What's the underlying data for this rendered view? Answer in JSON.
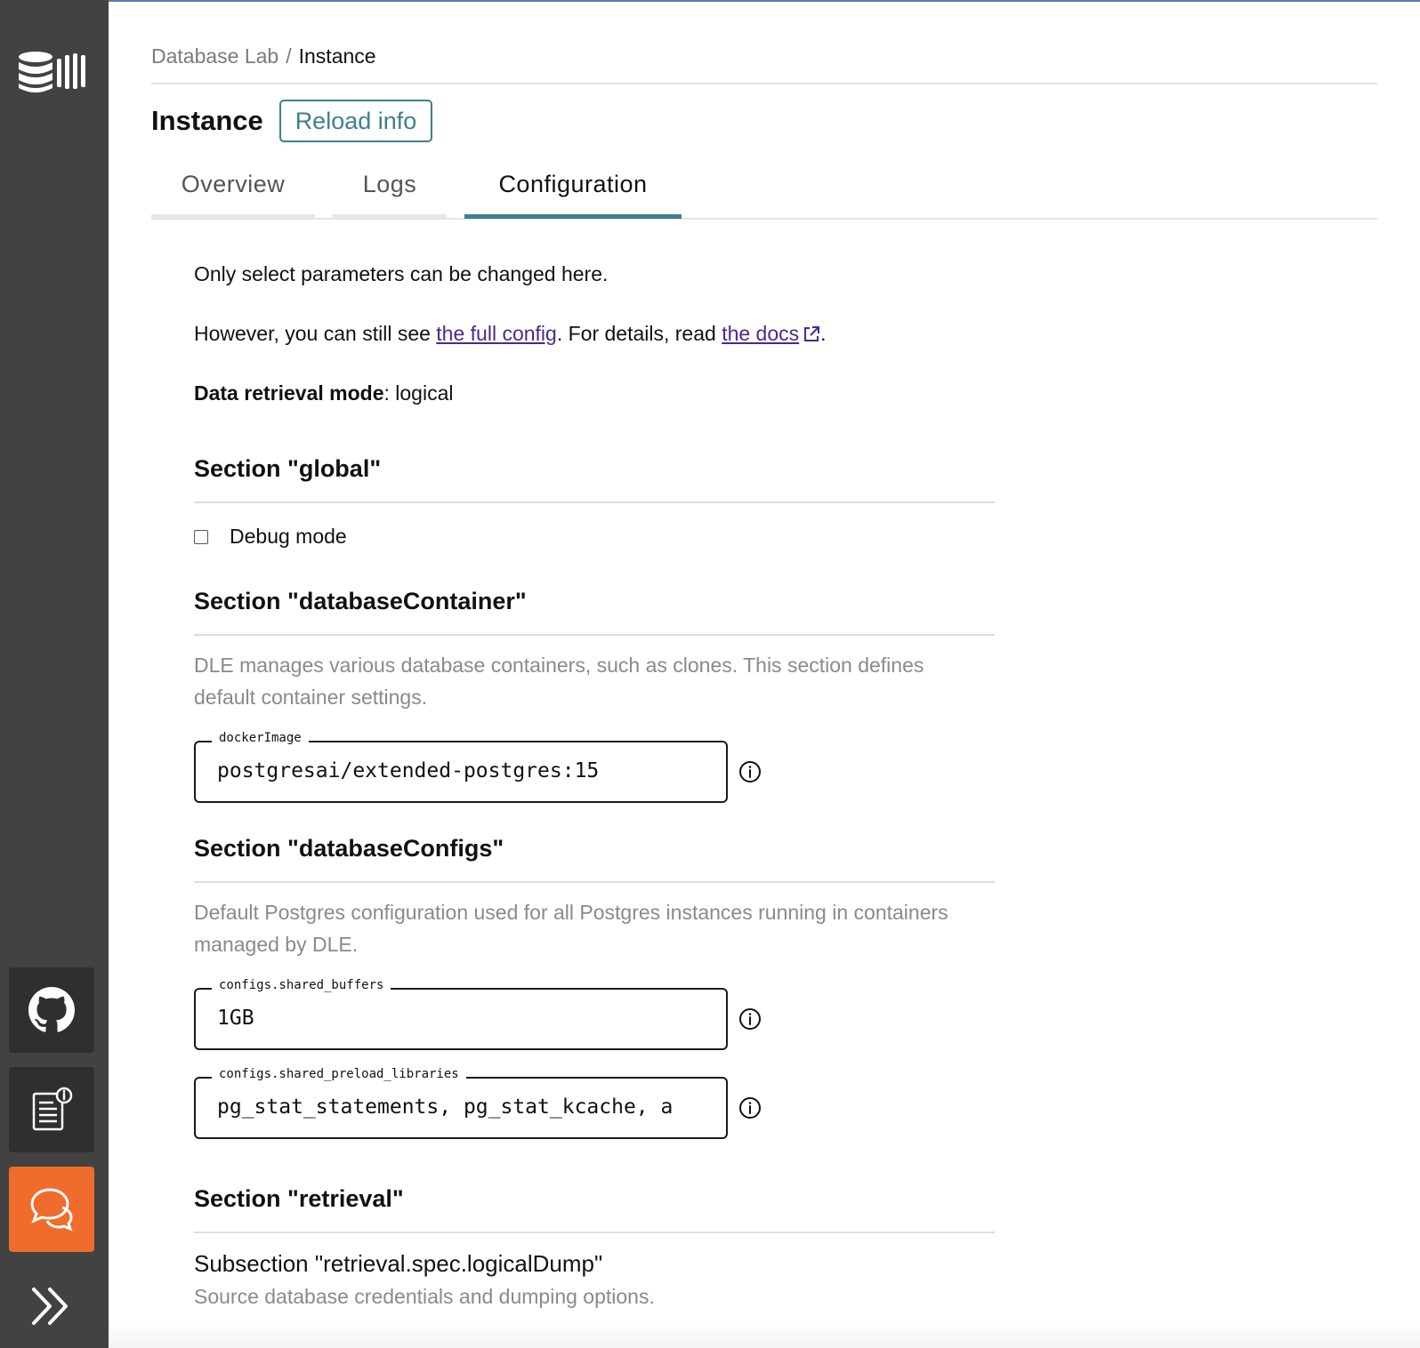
{
  "breadcrumb": {
    "root": "Database Lab",
    "separator": "/",
    "current": "Instance"
  },
  "page": {
    "title": "Instance",
    "reload_label": "Reload info"
  },
  "tabs": [
    {
      "label": "Overview",
      "active": false
    },
    {
      "label": "Logs",
      "active": false
    },
    {
      "label": "Configuration",
      "active": true
    }
  ],
  "intro": {
    "line1": "Only select parameters can be changed here.",
    "line2_prefix": "However, you can still see ",
    "full_config_link": "the full config",
    "line2_middle": ". For details, read ",
    "docs_link": "the docs",
    "line2_suffix": ".",
    "mode_label": "Data retrieval mode",
    "mode_sep": ": ",
    "mode_value": "logical"
  },
  "sections": {
    "global": {
      "title": "Section \"global\"",
      "debug_label": "Debug mode",
      "debug_checked": false
    },
    "databaseContainer": {
      "title": "Section \"databaseContainer\"",
      "description": "DLE manages various database containers, such as clones. This section defines default container settings.",
      "docker_image_label": "dockerImage",
      "docker_image_value": "postgresai/extended-postgres:15"
    },
    "databaseConfigs": {
      "title": "Section \"databaseConfigs\"",
      "description": "Default Postgres configuration used for all Postgres instances running in containers managed by DLE.",
      "shared_buffers_label": "configs.shared_buffers",
      "shared_buffers_value": "1GB",
      "preload_label": "configs.shared_preload_libraries",
      "preload_value": "pg_stat_statements, pg_stat_kcache, a"
    },
    "retrieval": {
      "title": "Section \"retrieval\"",
      "subsection_title": "Subsection \"retrieval.spec.logicalDump\"",
      "subsection_description": "Source database credentials and dumping options."
    }
  },
  "icons": {
    "logo": "database-logo-icon",
    "github": "github-icon",
    "docs": "docs-icon",
    "chat": "chat-icon",
    "expand": "chevron-double-right-icon",
    "info": "info-icon",
    "external": "external-link-icon"
  },
  "colors": {
    "sidebar": "#424242",
    "accent": "#3f7f8c",
    "chat": "#ef6c2c",
    "link": "#4b2a8a"
  }
}
